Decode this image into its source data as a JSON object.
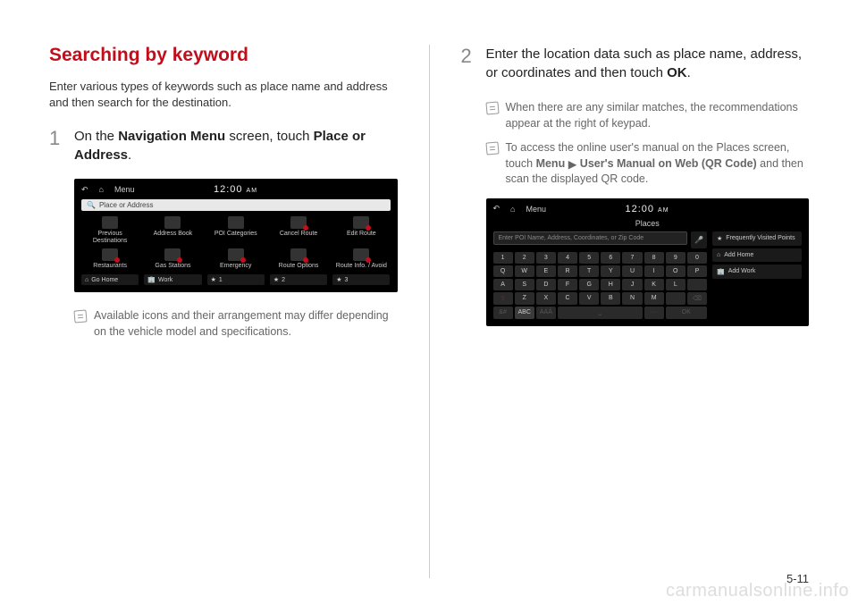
{
  "page_number": "5-11",
  "watermark": "carmanualsonline.info",
  "left": {
    "title": "Searching by keyword",
    "intro": "Enter various types of keywords such as place name and address and then search for the destination.",
    "step1_num": "1",
    "step1_pre": "On the ",
    "step1_b1": "Navigation Menu",
    "step1_mid": " screen, touch ",
    "step1_b2": "Place or Address",
    "step1_post": ".",
    "note1": "Available icons and their arrangement may differ depending on the vehicle model and specifications."
  },
  "right": {
    "step2_num": "2",
    "step2_pre": "Enter the location data such as place name, address, or coordinates and then touch ",
    "step2_b1": "OK",
    "step2_post": ".",
    "note1": "When there are any similar matches, the recommendations appear at the right of keypad.",
    "note2_pre": "To access the online user's manual on the Places screen, touch ",
    "note2_b1": "Menu",
    "note2_arrow": "▶",
    "note2_b2": "User's Manual on Web (QR Code)",
    "note2_post": " and then scan the displayed QR code."
  },
  "ss1": {
    "menu": "Menu",
    "clock": "12:00",
    "ampm": "AM",
    "search": "Place or Address",
    "items": [
      "Previous Destinations",
      "Address Book",
      "POI Categories",
      "Cancel Route",
      "Edit Route",
      "Restaurants",
      "Gas Stations",
      "Emergency",
      "Route Options",
      "Route Info. / Avoid"
    ],
    "bottom": [
      "Go Home",
      "Work",
      "1",
      "2",
      "3"
    ]
  },
  "ss2": {
    "menu": "Menu",
    "clock": "12:00",
    "ampm": "AM",
    "title": "Places",
    "input": "Enter POI Name, Address, Coordinates, or Zip Code",
    "row1": [
      "1",
      "2",
      "3",
      "4",
      "5",
      "6",
      "7",
      "8",
      "9",
      "0"
    ],
    "row2": [
      "Q",
      "W",
      "E",
      "R",
      "T",
      "Y",
      "U",
      "I",
      "O",
      "P"
    ],
    "row3": [
      "A",
      "S",
      "D",
      "F",
      "G",
      "H",
      "J",
      "K",
      "L"
    ],
    "row4_shift": "⇧",
    "row4": [
      "Z",
      "X",
      "C",
      "V",
      "B",
      "N",
      "M"
    ],
    "row4_bs": "⌫",
    "row5_mode": "&#",
    "row5_abc": "ABC",
    "row5_aaa": "ÀÁÂ",
    "row5_ok": "OK",
    "right_items": [
      "Frequently Visited Points",
      "Add Home",
      "Add Work"
    ]
  }
}
